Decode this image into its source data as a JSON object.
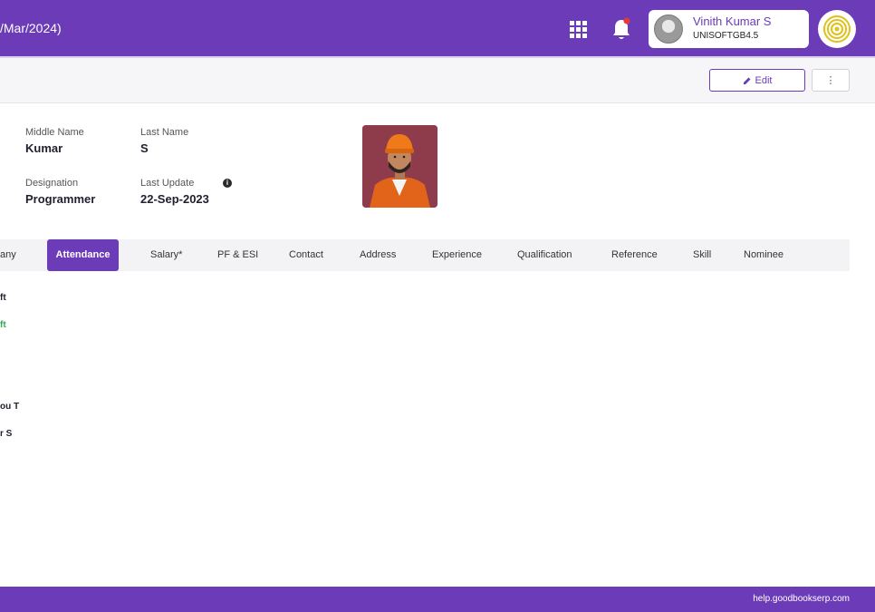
{
  "header": {
    "title_fragment": "/Mar/2024)",
    "user_name": "Vinith Kumar S",
    "user_code": "UNISOFTGB4.5"
  },
  "toolbar": {
    "edit_label": "Edit",
    "more_label": "⋮"
  },
  "profile": {
    "middle_name_label": "Middle Name",
    "middle_name_value": "Kumar",
    "last_name_label": "Last Name",
    "last_name_value": "S",
    "designation_label": "Designation",
    "designation_value": "Programmer",
    "last_update_label": "Last Update",
    "last_update_value": "22-Sep-2023"
  },
  "tabs": [
    {
      "label": "any",
      "active": false
    },
    {
      "label": "Attendance",
      "active": true
    },
    {
      "label": "Salary*",
      "active": false
    },
    {
      "label": "PF & ESI",
      "active": false
    },
    {
      "label": "Contact",
      "active": false
    },
    {
      "label": "Address",
      "active": false
    },
    {
      "label": "Experience",
      "active": false
    },
    {
      "label": "Qualification",
      "active": false
    },
    {
      "label": "Reference",
      "active": false
    },
    {
      "label": "Skill",
      "active": false
    },
    {
      "label": "Nominee",
      "active": false
    }
  ],
  "content_rows": [
    {
      "text": "ft",
      "color": "#1f1f2e"
    },
    {
      "text": "ft",
      "color": "#2fa84f"
    },
    {
      "text": "ou T",
      "color": "#1f1f2e"
    },
    {
      "text": "r S",
      "color": "#1f1f2e"
    }
  ],
  "footer": {
    "help_link": "help.goodbookserp.com"
  },
  "colors": {
    "brand": "#6c3bb8",
    "notification_dot": "#e53935",
    "green_text": "#2fa84f"
  }
}
